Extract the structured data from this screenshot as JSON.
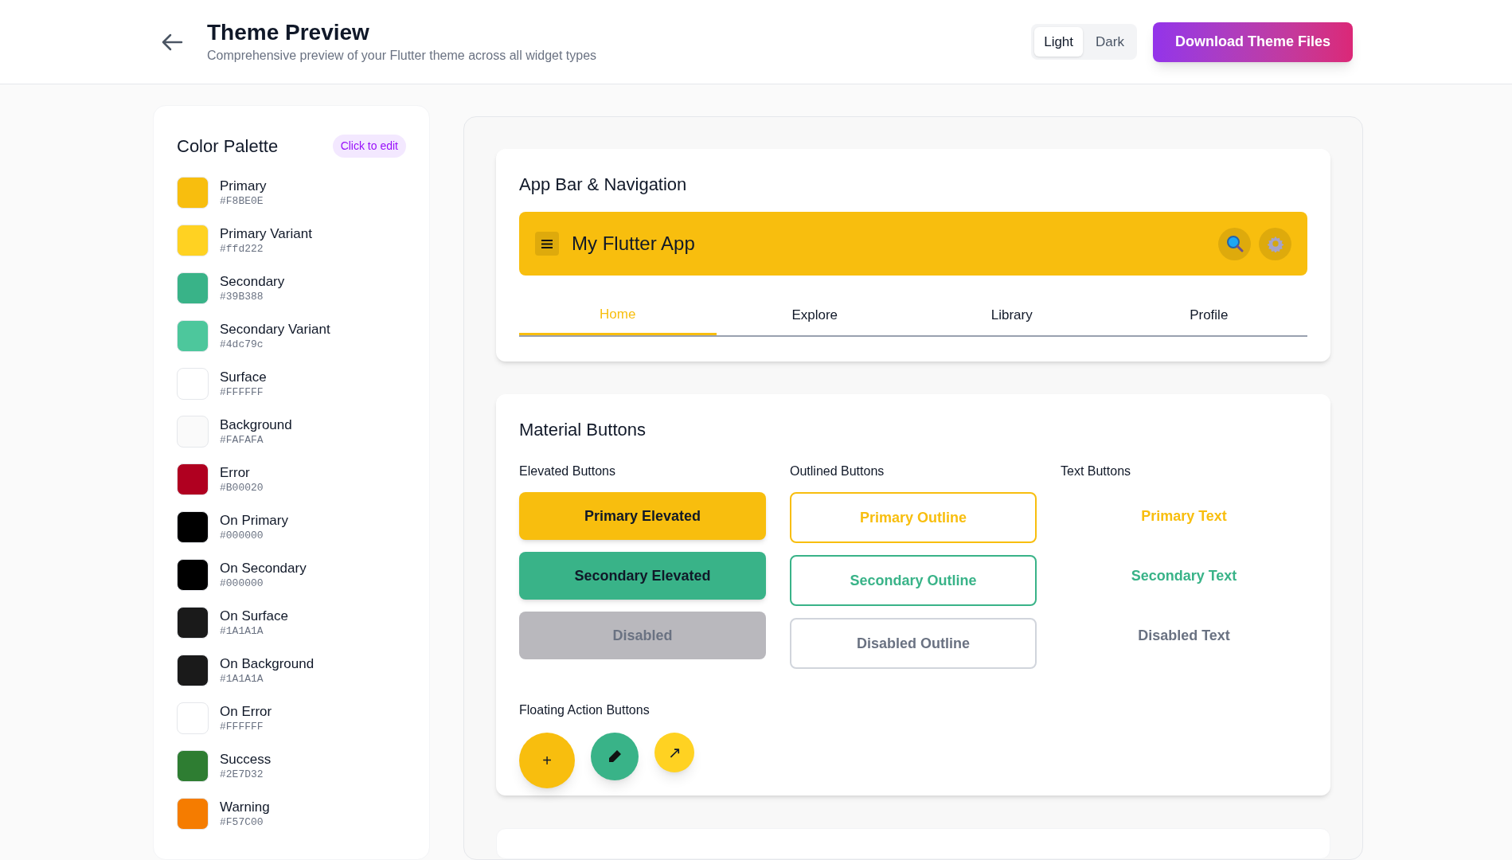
{
  "header": {
    "title": "Theme Preview",
    "subtitle": "Comprehensive preview of your Flutter theme across all widget types",
    "modes": [
      {
        "label": "Light",
        "selected": true
      },
      {
        "label": "Dark",
        "selected": false
      }
    ],
    "download_button": "Download Theme Files"
  },
  "palette": {
    "title": "Color Palette",
    "badge": "Click to edit",
    "colors": [
      {
        "name": "Primary",
        "hex": "#F8BE0E",
        "color": "#f8be0e"
      },
      {
        "name": "Primary Variant",
        "hex": "#ffd222",
        "color": "#ffd222"
      },
      {
        "name": "Secondary",
        "hex": "#39B388",
        "color": "#39b388"
      },
      {
        "name": "Secondary Variant",
        "hex": "#4dc79c",
        "color": "#4dc79c"
      },
      {
        "name": "Surface",
        "hex": "#FFFFFF",
        "color": "#ffffff"
      },
      {
        "name": "Background",
        "hex": "#FAFAFA",
        "color": "#fafafa"
      },
      {
        "name": "Error",
        "hex": "#B00020",
        "color": "#b00020"
      },
      {
        "name": "On Primary",
        "hex": "#000000",
        "color": "#000000"
      },
      {
        "name": "On Secondary",
        "hex": "#000000",
        "color": "#000000"
      },
      {
        "name": "On Surface",
        "hex": "#1A1A1A",
        "color": "#1a1a1a"
      },
      {
        "name": "On Background",
        "hex": "#1A1A1A",
        "color": "#1a1a1a"
      },
      {
        "name": "On Error",
        "hex": "#FFFFFF",
        "color": "#ffffff"
      },
      {
        "name": "Success",
        "hex": "#2E7D32",
        "color": "#2e7d32"
      },
      {
        "name": "Warning",
        "hex": "#F57C00",
        "color": "#f57c00"
      }
    ]
  },
  "app_bar_section": {
    "title": "App Bar & Navigation",
    "app_title": "My Flutter App",
    "tabs": [
      {
        "label": "Home",
        "selected": true
      },
      {
        "label": "Explore",
        "selected": false
      },
      {
        "label": "Library",
        "selected": false
      },
      {
        "label": "Profile",
        "selected": false
      }
    ]
  },
  "buttons_section": {
    "title": "Material Buttons",
    "groups": [
      {
        "kind": "elevated",
        "title": "Elevated Buttons",
        "buttons": [
          {
            "label": "Primary Elevated",
            "disabled": false
          },
          {
            "label": "Secondary Elevated",
            "disabled": false
          },
          {
            "label": "Disabled",
            "disabled": true
          }
        ]
      },
      {
        "kind": "outlined",
        "title": "Outlined Buttons",
        "buttons": [
          {
            "label": "Primary Outline",
            "disabled": false
          },
          {
            "label": "Secondary Outline",
            "disabled": false
          },
          {
            "label": "Disabled Outline",
            "disabled": true
          }
        ]
      },
      {
        "kind": "text",
        "title": "Text Buttons",
        "buttons": [
          {
            "label": "Primary Text",
            "disabled": false
          },
          {
            "label": "Secondary Text",
            "disabled": false
          },
          {
            "label": "Disabled Text",
            "disabled": true
          }
        ]
      }
    ],
    "fab_title": "Floating Action Buttons",
    "fabs": [
      {
        "color": "#f8be0e",
        "label": "+"
      },
      {
        "color": "#39b388"
      },
      {
        "color": "#ffd222",
        "label": "↗"
      }
    ]
  }
}
